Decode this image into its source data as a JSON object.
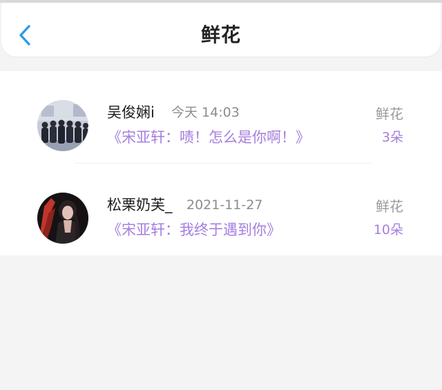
{
  "header": {
    "title": "鲜花",
    "back_icon": "chevron-left-icon"
  },
  "colors": {
    "accent_blue": "#2f9be6",
    "message_purple": "#a57ee0",
    "muted_gray": "#9a9a9a",
    "background": "#f5f4f5"
  },
  "items": [
    {
      "name": "吴俊娴i",
      "time": "今天 14:03",
      "message": "《宋亚轩：啧！怎么是你啊！》",
      "gift": "鲜花",
      "count": "3朵"
    },
    {
      "name": "松栗奶芙_",
      "time": "2021-11-27",
      "message": "《宋亚轩：我终于遇到你》",
      "gift": "鲜花",
      "count": "10朵"
    }
  ]
}
